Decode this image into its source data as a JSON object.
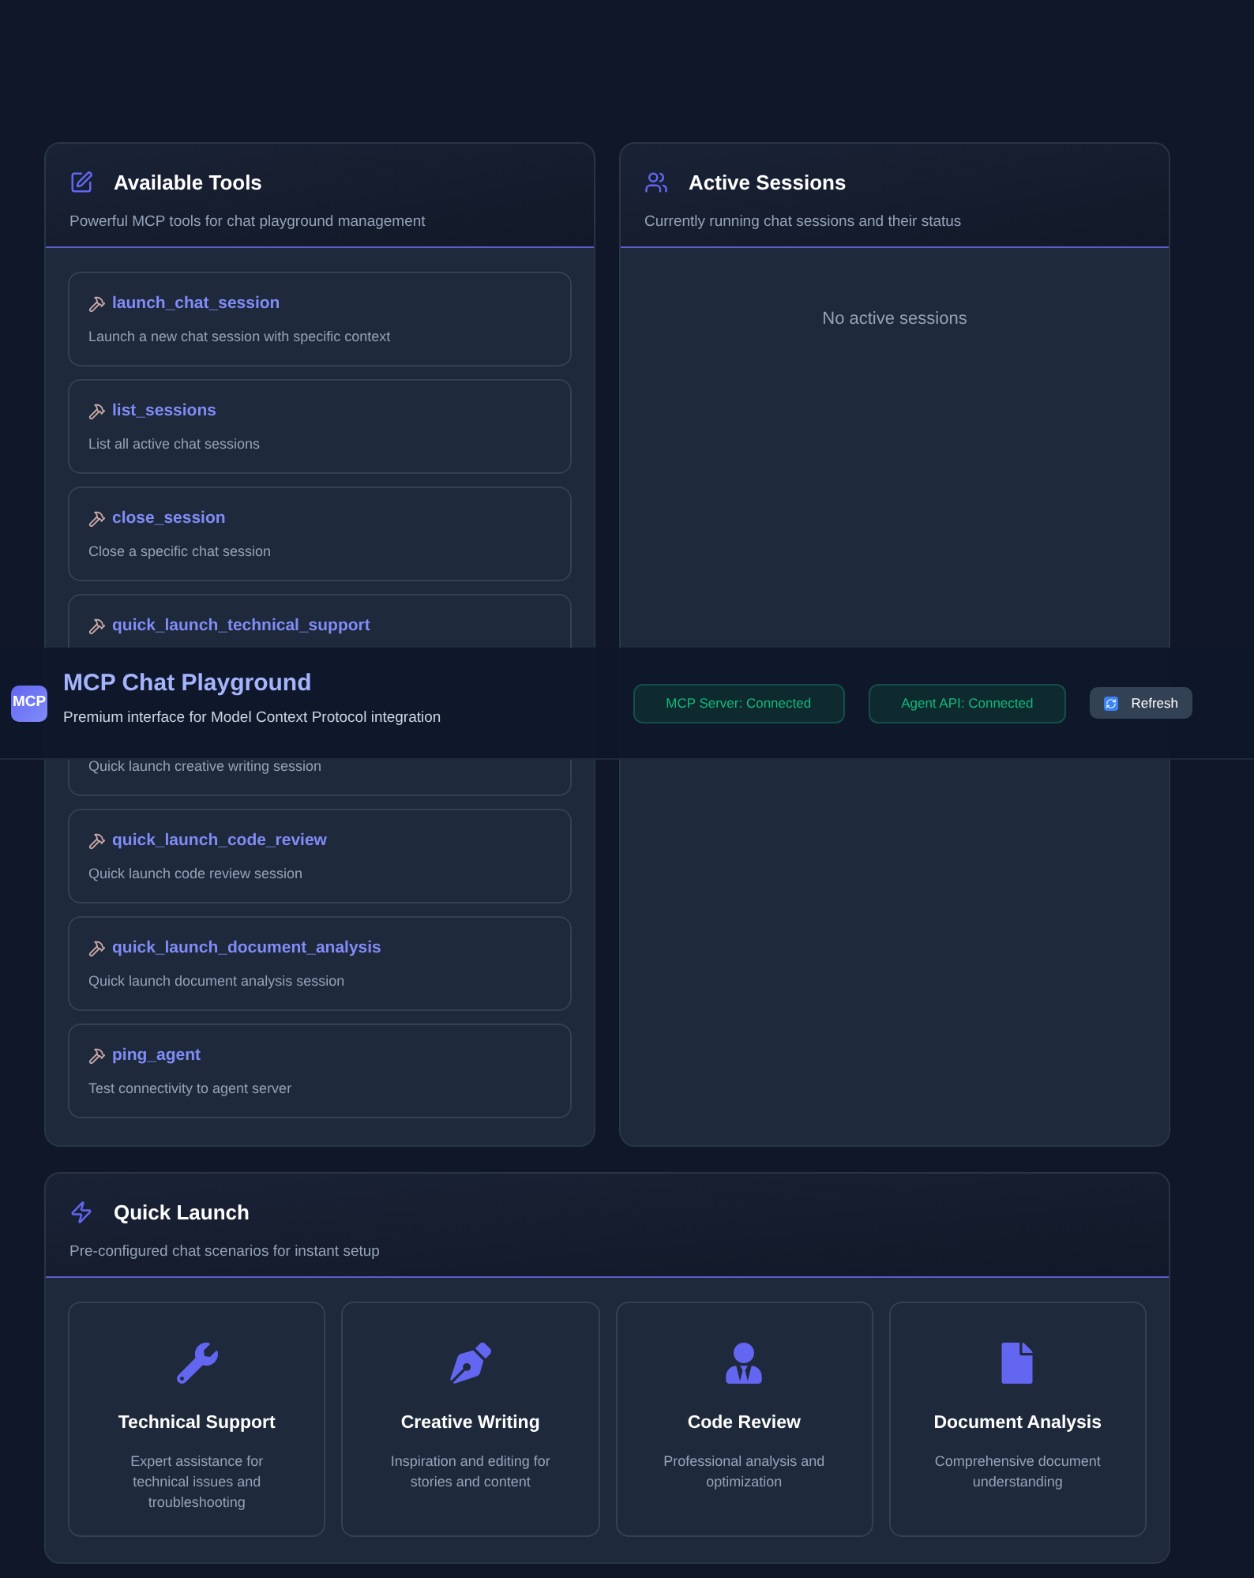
{
  "header": {
    "logo": "MCP",
    "title": "MCP Chat Playground",
    "subtitle": "Premium interface for Model Context Protocol integration",
    "statuses": [
      {
        "label": "MCP Server: Connected",
        "connected": true
      },
      {
        "label": "Agent API: Connected",
        "connected": true
      }
    ],
    "refresh_button": "Refresh"
  },
  "tools_panel": {
    "title": "Available Tools",
    "subtitle": "Powerful MCP tools for chat playground management",
    "tools": [
      {
        "name": "launch_chat_session",
        "description": "Launch a new chat session with specific context"
      },
      {
        "name": "list_sessions",
        "description": "List all active chat sessions"
      },
      {
        "name": "close_session",
        "description": "Close a specific chat session"
      },
      {
        "name": "quick_launch_technical_support"
      },
      {
        "description": "Quick launch creative writing session"
      },
      {
        "name": "quick_launch_code_review",
        "description": "Quick launch code review session"
      },
      {
        "name": "quick_launch_document_analysis",
        "description": "Quick launch document analysis session"
      },
      {
        "name": "ping_agent",
        "description": "Test connectivity to agent server"
      }
    ]
  },
  "sessions_panel": {
    "title": "Active Sessions",
    "subtitle": "Currently running chat sessions and their status",
    "empty_message": "No active sessions"
  },
  "quick_launch": {
    "title": "Quick Launch",
    "subtitle": "Pre-configured chat scenarios for instant setup",
    "scenarios": [
      {
        "kind": "wrench",
        "title": "Technical Support",
        "description": "Expert assistance for technical issues and troubleshooting"
      },
      {
        "kind": "pen",
        "title": "Creative Writing",
        "description": "Inspiration and editing for stories and content"
      },
      {
        "kind": "person",
        "title": "Code Review",
        "description": "Professional analysis and optimization"
      },
      {
        "kind": "document",
        "title": "Document Analysis",
        "description": "Comprehensive document understanding"
      }
    ]
  }
}
